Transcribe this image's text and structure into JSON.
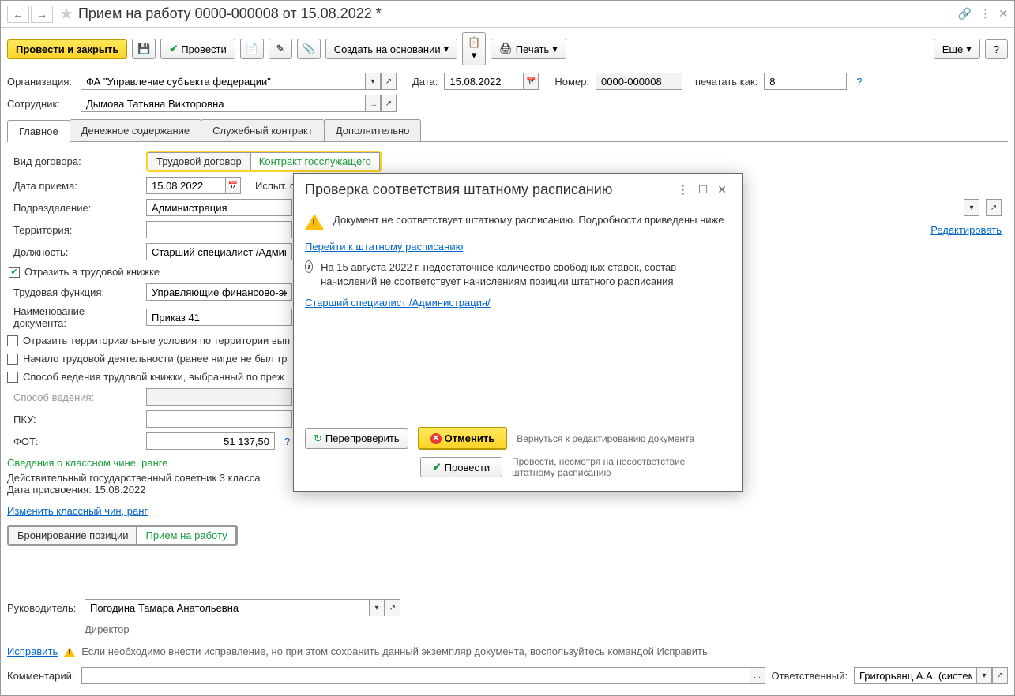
{
  "title": "Прием на работу 0000-000008 от 15.08.2022 *",
  "toolbar": {
    "post_close": "Провести и закрыть",
    "post": "Провести",
    "create_based": "Создать на основании",
    "print": "Печать",
    "more": "Еще",
    "help": "?"
  },
  "header": {
    "org_label": "Организация:",
    "org_value": "ФА \"Управление субъекта федерации\"",
    "date_label": "Дата:",
    "date_value": "15.08.2022",
    "number_label": "Номер:",
    "number_value": "0000-000008",
    "print_as_label": "печатать как:",
    "print_as_value": "8",
    "employee_label": "Сотрудник:",
    "employee_value": "Дымова Татьяна Викторовна"
  },
  "tabs": {
    "main": "Главное",
    "money": "Денежное содержание",
    "contract": "Служебный контракт",
    "extra": "Дополнительно"
  },
  "main": {
    "contract_type_label": "Вид договора:",
    "seg_labor": "Трудовой договор",
    "seg_gov": "Контракт госслужащего",
    "hire_date_label": "Дата приема:",
    "hire_date_value": "15.08.2022",
    "trial_label": "Испыт. ср",
    "dept_label": "Подразделение:",
    "dept_value": "Администрация",
    "edit_link": "Редактировать",
    "territory_label": "Территория:",
    "position_label": "Должность:",
    "position_value": "Старший специалист /Админис",
    "reflect_workbook": "Отразить в трудовой книжке",
    "labor_func_label": "Трудовая функция:",
    "labor_func_value": "Управляющие финансово-экон",
    "doc_name_label": "Наименование документа:",
    "doc_name_value": "Приказ 41",
    "chk_territory": "Отразить территориальные условия по территории вып",
    "chk_start": "Начало трудовой деятельности (ранее нигде не был тр",
    "chk_method": "Способ ведения трудовой книжки, выбранный по преж",
    "method_label": "Способ ведения:",
    "pku_label": "ПКУ:",
    "fot_label": "ФОТ:",
    "fot_value": "51 137,50",
    "rank_info": "Сведения о классном чине, ранге",
    "rank_line1": "Действительный государственный советник 3 класса",
    "rank_line2": "Дата присвоения: 15.08.2022",
    "change_rank": "Изменить классный чин, ранг",
    "seg_booking": "Бронирование позиции",
    "seg_hire": "Прием на работу"
  },
  "dialog": {
    "title": "Проверка соответствия штатному расписанию",
    "warn_msg": "Документ не соответствует штатному расписанию. Подробности приведены ниже",
    "goto_link": "Перейти к штатному расписанию",
    "info_msg": "На 15 августа 2022 г. недостаточное количество свободных ставок, состав начислений не соответствует начислениям позиции штатного расписания",
    "position_link": "Старший специалист /Администрация/",
    "recheck": "Перепроверить",
    "cancel": "Отменить",
    "cancel_help": "Вернуться к редактированию документа",
    "post": "Провести",
    "post_help": "Провести, несмотря на несоответствие штатному расписанию"
  },
  "footer": {
    "head_label": "Руководитель:",
    "head_value": "Погодина Тамара Анатольевна",
    "director": "Директор",
    "fix": "Исправить",
    "fix_msg": "Если необходимо внести исправление, но при этом сохранить данный экземпляр документа, воспользуйтесь командой Исправить",
    "comment_label": "Комментарий:",
    "resp_label": "Ответственный:",
    "resp_value": "Григорьянц А.А. (системн"
  }
}
